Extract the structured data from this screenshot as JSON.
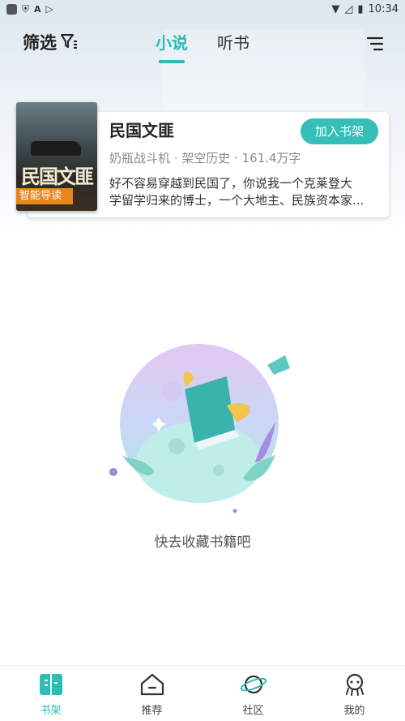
{
  "status": {
    "time": "10:34"
  },
  "header": {
    "filter_label": "筛选",
    "tabs": [
      {
        "label": "小说",
        "active": true
      },
      {
        "label": "听书",
        "active": false
      }
    ]
  },
  "book": {
    "cover_title": "民国文匪",
    "cover_badge": "智能导读",
    "title": "民国文匪",
    "meta": "奶瓶战斗机 · 架空历史 · 161.4万字",
    "desc_line1": "好不容易穿越到民国了，你说我一个克莱登大",
    "desc_line2": "学留学归来的博士，一个大地主、民族资本家...",
    "add_button": "加入书架"
  },
  "empty_state": {
    "text": "快去收藏书籍吧"
  },
  "bottom_nav": {
    "items": [
      {
        "label": "书架",
        "icon": "bookshelf-icon",
        "active": true
      },
      {
        "label": "推荐",
        "icon": "recommend-icon",
        "active": false
      },
      {
        "label": "社区",
        "icon": "planet-icon",
        "active": false
      },
      {
        "label": "我的",
        "icon": "profile-icon",
        "active": false
      }
    ]
  },
  "colors": {
    "accent": "#2bbdb6",
    "badge": "#e8861c"
  }
}
